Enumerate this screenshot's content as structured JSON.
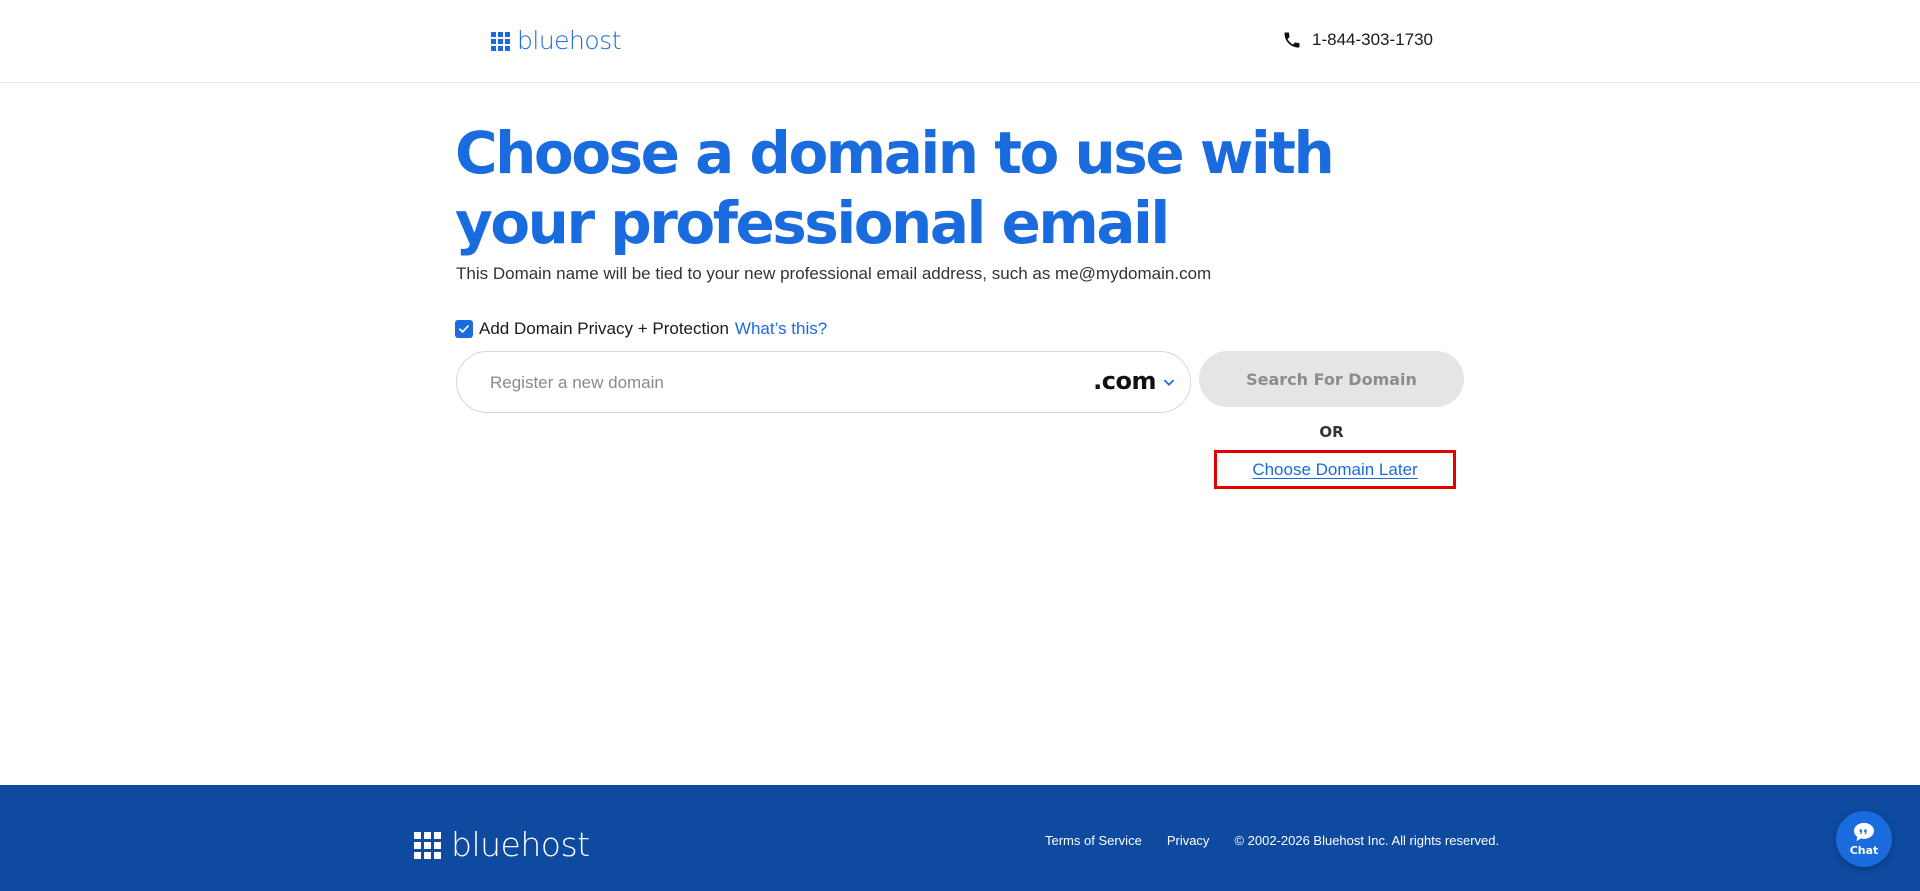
{
  "header": {
    "logo_text": "bluehost",
    "phone_icon": "phone-icon",
    "phone_number": "1-844-303-1730"
  },
  "main": {
    "title": "Choose a domain to use with your professional email",
    "subtitle": "This Domain name will be tied to your new professional email address, such as me@mydomain.com",
    "privacy": {
      "checked": true,
      "label": "Add Domain Privacy + Protection",
      "link": "What’s this?"
    },
    "domain_search": {
      "value": "",
      "placeholder": "Register a new domain",
      "tld": ".com",
      "button_label": "Search For Domain"
    },
    "or_text": "OR",
    "choose_later": "Choose Domain Later"
  },
  "footer": {
    "logo_text": "bluehost",
    "links": {
      "terms": "Terms of Service",
      "privacy": "Privacy"
    },
    "copyright": "© 2002-2026 Bluehost Inc. All rights reserved."
  },
  "chat": {
    "icon": "chat-icon",
    "label": "Chat"
  },
  "colors": {
    "brand_blue": "#196bde",
    "footer_blue": "#0e4aa0",
    "highlight_red": "#e40000",
    "disabled_gray": "#e5e5e5"
  }
}
